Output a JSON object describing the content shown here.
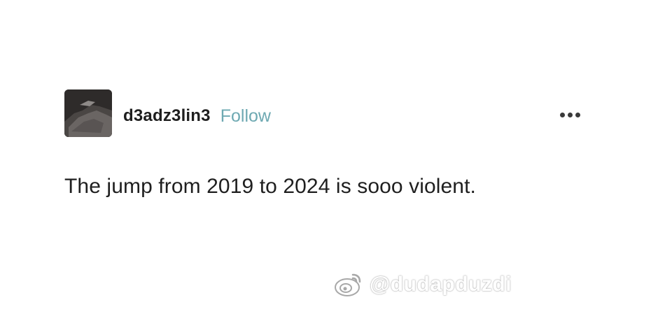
{
  "post": {
    "author": {
      "username": "d3adz3lin3",
      "avatar": "avatar-image"
    },
    "follow_label": "Follow",
    "more_icon": "more-horizontal-icon",
    "body_text": "The jump from 2019 to 2024 is sooo violent."
  },
  "watermark": {
    "icon": "weibo-logo-icon",
    "text": "@dudapduzdi"
  },
  "colors": {
    "follow": "#6ea9b2",
    "text": "#1f1f1f",
    "background": "#ffffff"
  }
}
